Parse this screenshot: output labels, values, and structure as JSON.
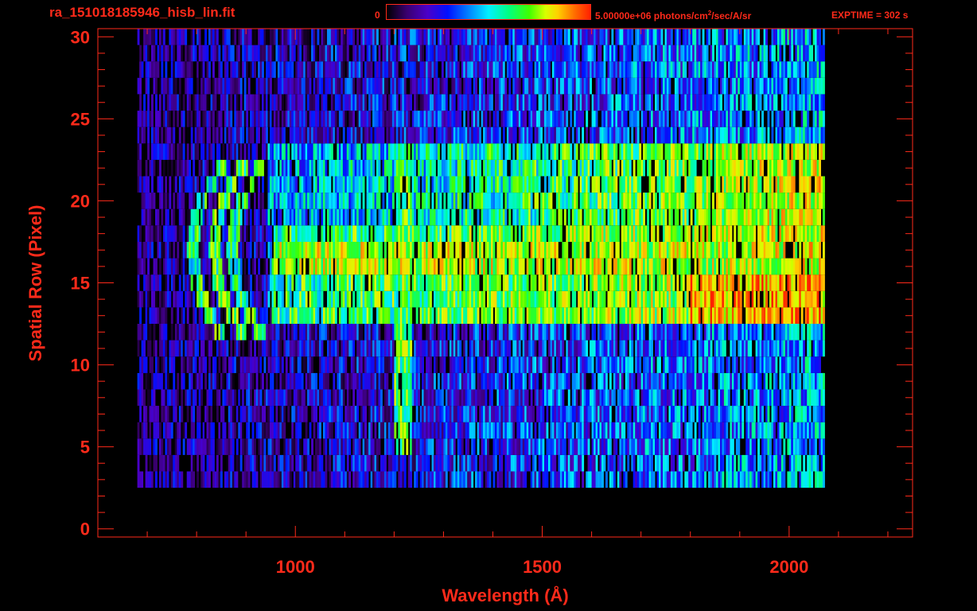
{
  "header": {
    "file_title": "ra_151018185946_hisb_lin.fit",
    "colorbar_min": "0",
    "colorbar_max_prefix": "5.00000e+06 photons/cm",
    "colorbar_max_sup": "2",
    "colorbar_max_suffix": "/sec/A/sr",
    "exptime": "EXPTIME = 302 s"
  },
  "colors": {
    "axis": "#ff2a1a",
    "background": "#000000"
  },
  "chart_data": {
    "type": "heatmap",
    "title": "ra_151018185946_hisb_lin.fit",
    "xlabel": "Wavelength (Å)",
    "ylabel": "Spatial Row (Pixel)",
    "xlim": [
      600,
      2250
    ],
    "ylim": [
      -0.5,
      30.5
    ],
    "x_ticks": [
      1000,
      1500,
      2000
    ],
    "y_ticks": [
      0,
      5,
      10,
      15,
      20,
      25,
      30
    ],
    "colorbar_range": [
      0,
      5000000
    ],
    "colorbar_unit": "photons/cm^2/sec/A/sr",
    "colormap": [
      "#000000",
      "#3a0070",
      "#4b00c8",
      "#0010ff",
      "#0080ff",
      "#00f0ff",
      "#00ff80",
      "#40ff00",
      "#d8ff00",
      "#ffd000",
      "#ff7000",
      "#ff2000"
    ],
    "rows_detected_range": [
      3,
      30
    ],
    "wavelength_coverage": [
      680,
      2070
    ],
    "bright_rows": {
      "rows": [
        13,
        18
      ],
      "peak_intensity_fraction": 0.85,
      "peak_wavelength_range": [
        1800,
        2060
      ]
    },
    "extended_band_rows": [
      14,
      23
    ],
    "emission_line_wavelength": 1216,
    "emission_line_rows": [
      5,
      23
    ]
  }
}
